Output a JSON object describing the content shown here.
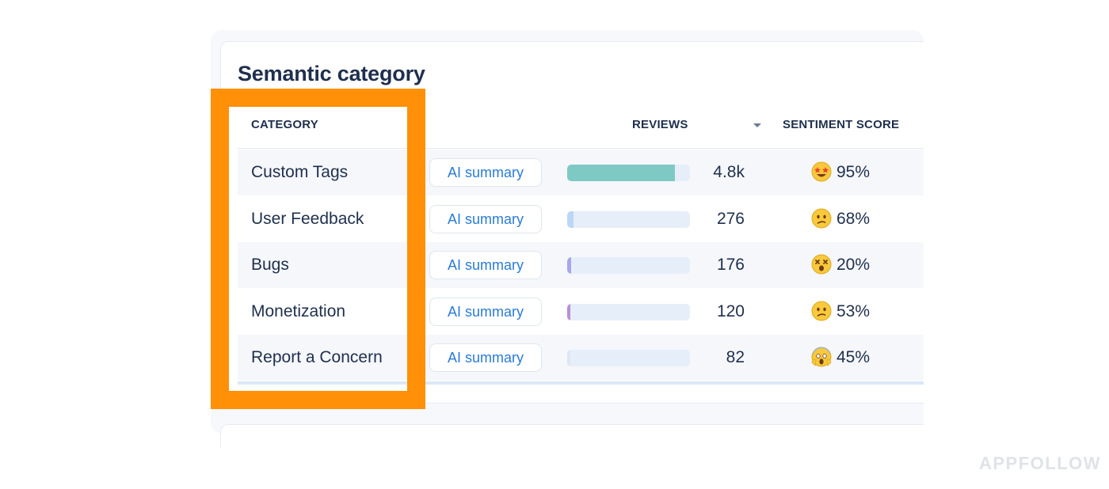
{
  "title": "Semantic category",
  "columns": {
    "category": "CATEGORY",
    "reviews": "REVIEWS",
    "sentiment": "SENTIMENT SCORE"
  },
  "rows": [
    {
      "category": "Custom Tags",
      "button": "AI summary",
      "reviews": "4.8k",
      "bar_fraction": 0.88,
      "bar_color": "#7fc9c4",
      "emoji": "star-struck-emoji",
      "sentiment": "95%"
    },
    {
      "category": "User Feedback",
      "button": "AI summary",
      "reviews": "276",
      "bar_fraction": 0.05,
      "bar_color": "#bcd6f5",
      "emoji": "confused-emoji",
      "sentiment": "68%"
    },
    {
      "category": "Bugs",
      "button": "AI summary",
      "reviews": "176",
      "bar_fraction": 0.035,
      "bar_color": "#a8a6ee",
      "emoji": "dizzy-emoji",
      "sentiment": "20%"
    },
    {
      "category": "Monetization",
      "button": "AI summary",
      "reviews": "120",
      "bar_fraction": 0.025,
      "bar_color": "#b98fd6",
      "emoji": "confused-emoji",
      "sentiment": "53%"
    },
    {
      "category": "Report a Concern",
      "button": "AI summary",
      "reviews": "82",
      "bar_fraction": 0.015,
      "bar_color": "#dfe6f3",
      "emoji": "screaming-emoji",
      "sentiment": "45%"
    }
  ],
  "highlight_color": "#ff9008",
  "watermark": "APPFOLLOW"
}
